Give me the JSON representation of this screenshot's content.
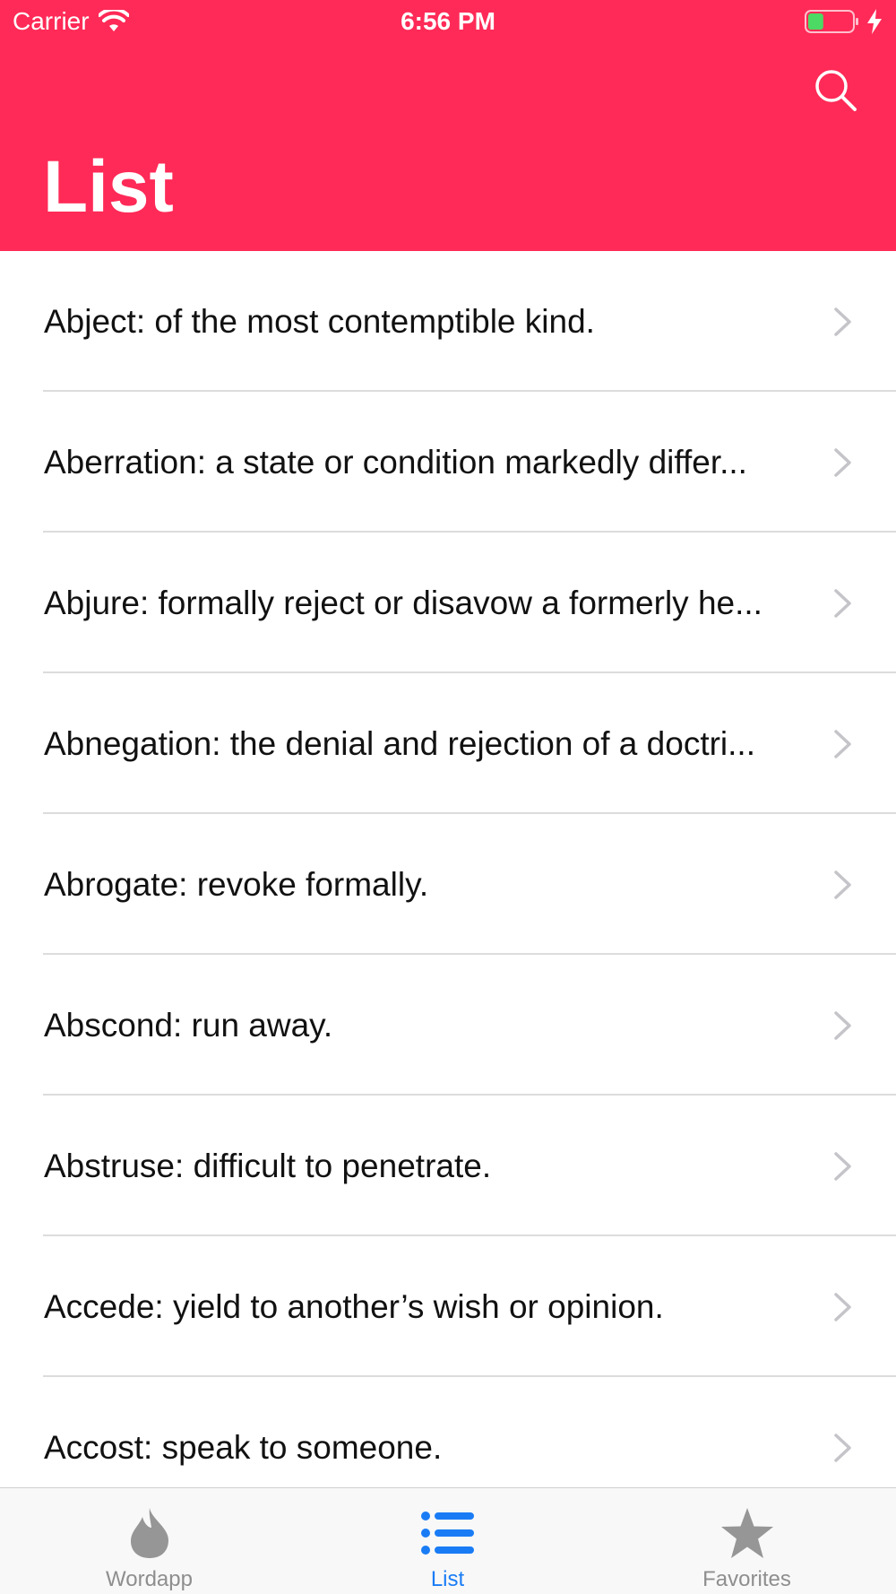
{
  "status_bar": {
    "carrier": "Carrier",
    "time": "6:56 PM",
    "battery_level": 0.35,
    "battery_color": "#4cd964"
  },
  "header": {
    "title": "List",
    "background_color": "#ff2a57",
    "search_icon": "search-icon"
  },
  "list": {
    "items": [
      {
        "label": "Abject: of the most contemptible kind."
      },
      {
        "label": "Aberration: a state or condition markedly differ..."
      },
      {
        "label": "Abjure: formally reject or disavow a formerly he..."
      },
      {
        "label": "Abnegation: the denial and rejection of a doctri..."
      },
      {
        "label": "Abrogate: revoke formally."
      },
      {
        "label": "Abscond: run away."
      },
      {
        "label": "Abstruse: difficult to penetrate."
      },
      {
        "label": "Accede: yield to another’s wish or opinion."
      },
      {
        "label": "Accost: speak to someone."
      }
    ]
  },
  "tabbar": {
    "active_color": "#1a7cf5",
    "inactive_color": "#8e8e8e",
    "tabs": [
      {
        "label": "Wordapp",
        "icon": "flame-icon",
        "active": false
      },
      {
        "label": "List",
        "icon": "list-icon",
        "active": true
      },
      {
        "label": "Favorites",
        "icon": "star-icon",
        "active": false
      }
    ]
  }
}
